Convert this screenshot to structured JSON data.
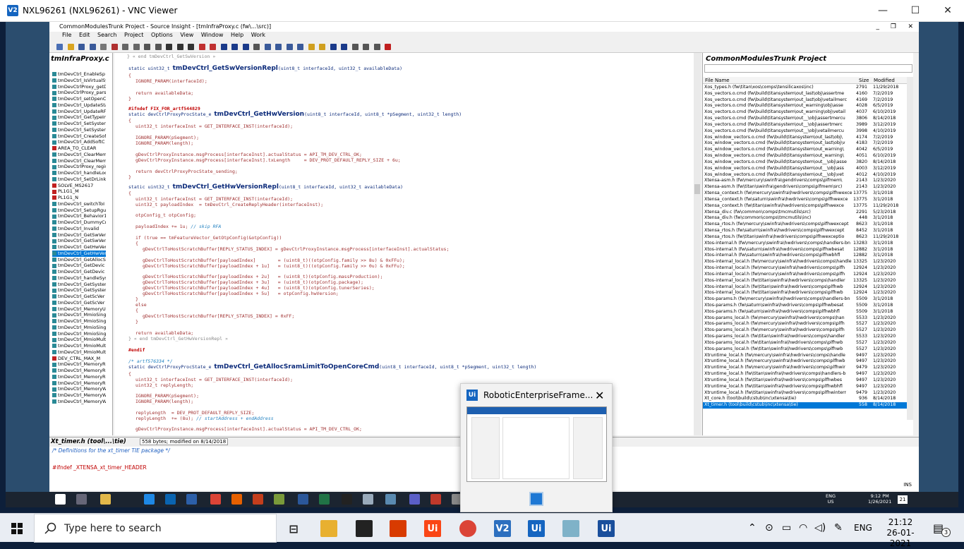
{
  "vnc": {
    "title": "NXL96261 (NXL96261) - VNC Viewer",
    "logo": "V2",
    "minimize": "—",
    "maximize": "☐",
    "close": "✕"
  },
  "si": {
    "title": "CommonModulesTrunk Project - Source Insight - [tmInfraProxy.c (fw\\...\\src)]",
    "menu": [
      "File",
      "Edit",
      "Search",
      "Project",
      "Options",
      "View",
      "Window",
      "Help",
      "Work"
    ],
    "window_controls": [
      "_",
      "❐",
      "✕"
    ],
    "symbol_window_title": "tmInfraProxy.c",
    "symbols": [
      {
        "label": "tmDevCtrl_EnableSp",
        "hash": false
      },
      {
        "label": "tmDevCtrl_IsVirtualSy",
        "hash": false
      },
      {
        "label": "tmDevCtrlProxy_getD",
        "hash": false
      },
      {
        "label": "tmDevCtrlProxy_pars",
        "hash": false
      },
      {
        "label": "tmDevCtrl_setOpenC",
        "hash": false
      },
      {
        "label": "tmDevCtrl_UpdateSta",
        "hash": false
      },
      {
        "label": "tmDevCtrl_UpdateRF",
        "hash": false
      },
      {
        "label": "tmDevCtrl_GetTypeIn",
        "hash": false
      },
      {
        "label": "tmDevCtrl_SetSysten",
        "hash": false
      },
      {
        "label": "tmDevCtrl_SetSysten",
        "hash": false
      },
      {
        "label": "tmDevCtrl_CreateSof",
        "hash": false
      },
      {
        "label": "tmDevCtrl_AddSoftC",
        "hash": false
      },
      {
        "label": "AREA_TO_CLEAR",
        "hash": true
      },
      {
        "label": "tmDevCtrl_ClearMem",
        "hash": false
      },
      {
        "label": "tmDevCtrl_ClearMem",
        "hash": false
      },
      {
        "label": "tmDevCtrlProxy_regis",
        "hash": false
      },
      {
        "label": "tmDevCtrl_handleLoc",
        "hash": false
      },
      {
        "label": "tmDevCtrl_SetDrLink",
        "hash": false
      },
      {
        "label": "SOLVE_MS2617",
        "hash": true
      },
      {
        "label": "PL1G1_M",
        "hash": true
      },
      {
        "label": "PL1G1_N",
        "hash": true
      },
      {
        "label": "tmDevCtrl_switchToI",
        "hash": false
      },
      {
        "label": "tmDevCtrl_SetupRgu",
        "hash": false
      },
      {
        "label": "tmDevCtrl_Behavior1",
        "hash": false
      },
      {
        "label": "tmDevCtrl_DummyCr",
        "hash": false
      },
      {
        "label": "tmDevCtrl_Invalid",
        "hash": false
      },
      {
        "label": "tmDevCtrl_GetSwVer",
        "hash": false
      },
      {
        "label": "tmDevCtrl_GetSwVer",
        "hash": false
      },
      {
        "label": "tmDevCtrl_GetHwVer",
        "hash": false
      },
      {
        "label": "tmDevCtrl_GetHwVer",
        "hash": false,
        "selected": true
      },
      {
        "label": "tmDevCtrl_GetAllocS",
        "hash": false
      },
      {
        "label": "tmDevCtrl_GetDevic",
        "hash": false
      },
      {
        "label": "tmDevCtrl_GetDevic",
        "hash": false
      },
      {
        "label": "tmDevCtrl_handleSys",
        "hash": false
      },
      {
        "label": "tmDevCtrl_GetSysten",
        "hash": false
      },
      {
        "label": "tmDevCtrl_GetSysten",
        "hash": false
      },
      {
        "label": "tmDevCtrl_GetScVer",
        "hash": false
      },
      {
        "label": "tmDevCtrl_GetScVer",
        "hash": false
      },
      {
        "label": "tmDevCtrl_MemoryU",
        "hash": false
      },
      {
        "label": "tmDevCtrl_MmioSing",
        "hash": false
      },
      {
        "label": "tmDevCtrl_MmioSing",
        "hash": false
      },
      {
        "label": "tmDevCtrl_MmioSing",
        "hash": false
      },
      {
        "label": "tmDevCtrl_MmioSing",
        "hash": false
      },
      {
        "label": "tmDevCtrl_MmioMult",
        "hash": false
      },
      {
        "label": "tmDevCtrl_MmioMult",
        "hash": false
      },
      {
        "label": "tmDevCtrl_MmioMult",
        "hash": false
      },
      {
        "label": "DEV_CTRL_MAX_M",
        "hash": true
      },
      {
        "label": "tmDevCtrl_MemoryR",
        "hash": false
      },
      {
        "label": "tmDevCtrl_MemoryR",
        "hash": false
      },
      {
        "label": "tmDevCtrl_MemoryR",
        "hash": false
      },
      {
        "label": "tmDevCtrl_MemoryR",
        "hash": false
      },
      {
        "label": "tmDevCtrl_MemoryW",
        "hash": false
      },
      {
        "label": "tmDevCtrl_MemoryW",
        "hash": false
      },
      {
        "label": "tmDevCtrl_MemoryW",
        "hash": false
      }
    ],
    "code": {
      "end_swver": "} « end tmDevCtrl_GetSwVersion »",
      "static1": "static uint32_t ",
      "fn1": "tmDevCtrl_GetSwVersionRepl",
      "args1": "(uint8_t interfaceId, uint32_t availableData)",
      "l_ignore1": "IGNORE_PARAM(interfaceId);",
      "l_ret1": "return availableData;",
      "l_ifndef": "#ifndef FIX_FOR_artf544829",
      "static2": "static devCtrlProxyProcState_e ",
      "fn2": "tmDevCtrl_GetHwVersion",
      "args2": "(uint8_t interfaceId, uint8_t *pSegment, uint32_t length)",
      "l_inst2": "uint32_t interfaceInst = GET_INTERFACE_INST(interfaceId);",
      "l_ign2a": "IGNORE_PARAM(pSegment);",
      "l_ign2b": "IGNORE_PARAM(length);",
      "l_act2": "gDevCtrlProxyInstance.msgProcess[interfaceInst].actualStatus = API_TM_DEV_CTRL_OK;",
      "l_tx2": "gDevCtrlProxyInstance.msgProcess[interfaceInst].txLength     = DEV_PROT_DEFAULT_REPLY_SIZE + 6u;",
      "l_ret2": "return devCtrlProxyProcState_sending;",
      "static3": "static uint32_t ",
      "fn3": "tmDevCtrl_GetHwVersionRepl",
      "args3": "(uint8_t interfaceId, uint32_t availableData)",
      "l_inst3": "uint32_t interfaceInst = GET_INTERFACE_INST(interfaceId);",
      "l_pidx3": "uint32_t payloadIndex  = tmDevCtrl_CreateReplyHeader(interfaceInst);",
      "l_otp3": "otpConfig_t otpConfig;",
      "l_pinc": "payloadIndex += 1u; ",
      "l_pinc_c": "// skip RFA",
      "l_if": "if (true == tmFeatureVector_GetOtpConfig(&otpConfig))",
      "l_rs1": "gDevCtrlToHostScratchBuffer[REPLY_STATUS_INDEX] = gDevCtrlProxyInstance.msgProcess[interfaceInst].actualStatus;",
      "l_p0": "gDevCtrlToHostScratchBuffer[payloadIndex]        = (uint8_t)((otpConfig.family >> 8u) & 0xFFu);",
      "l_p1": "gDevCtrlToHostScratchBuffer[payloadIndex + 1u]   = (uint8_t)((otpConfig.family >> 0u) & 0xFFu);",
      "l_p2": "gDevCtrlToHostScratchBuffer[payloadIndex + 2u]   = (uint8_t)(otpConfig.massProduction);",
      "l_p3": "gDevCtrlToHostScratchBuffer[payloadIndex + 3u]   = (uint8_t)(otpConfig.package);",
      "l_p4": "gDevCtrlToHostScratchBuffer[payloadIndex + 4u]   = (uint8_t)(otpConfig.tunerSeries);",
      "l_p5": "gDevCtrlToHostScratchBuffer[payloadIndex + 5u]   = otpConfig.hwVersion;",
      "l_else": "else",
      "l_rs2": "gDevCtrlToHostScratchBuffer[REPLY_STATUS_INDEX] = 0xFF;",
      "l_ret3": "return availableData;",
      "end_hwrepl": "} « end tmDevCtrl_GetHwVersionRepl »",
      "l_endif": "#endif",
      "l_artf": "/* artf576334 */",
      "static4": "static devCtrlProxyProcState_e ",
      "fn4": "tmDevCtrl_GetAllocSramLimitToOpenCoreCmd",
      "args4": "(uint8_t interfaceId, uint8_t *pSegment, uint32_t length)",
      "l_inst4": "uint32_t interfaceInst = GET_INTERFACE_INST(interfaceId);",
      "l_rlen4": "uint32_t replyLength;",
      "l_ign4a": "IGNORE_PARAM(pSegment);",
      "l_ign4b": "IGNORE_PARAM(length);",
      "l_rl4a": "replyLength  = DEV_PROT_DEFAULT_REPLY_SIZE;",
      "l_rl4b": "replyLength  += (8u); ",
      "l_rl4b_c": "// startAddress + endAddress",
      "l_act4": "gDevCtrlProxyInstance.msgProcess[interfaceInst].actualStatus = API_TM_DEV_CTRL_OK;"
    },
    "project": {
      "title": "CommonModulesTrunk Project",
      "col_name": "File Name",
      "col_size": "Size",
      "col_modified": "Modified",
      "files": [
        {
          "name": "Xos_types.h (fw\\titan\\xos\\comps\\tensilicaxos\\inc)",
          "size": "2791",
          "mod": "11/29/2018"
        },
        {
          "name": "Xos_vectors.o.cmd (fw\\build\\titansystem\\out_last\\obj\\assertme",
          "size": "4160",
          "mod": "7/2/2019"
        },
        {
          "name": "Xos_vectors.o.cmd (fw\\build\\titansystem\\out_last\\obj\\vetailmerc",
          "size": "4169",
          "mod": "7/2/2019"
        },
        {
          "name": "Xos_vectors.o.cmd (fw\\build\\titansystem\\out_warning\\obj\\asse",
          "size": "4028",
          "mod": "6/5/2019"
        },
        {
          "name": "Xos_vectors.o.cmd (fw\\build\\titansystem\\out_warning\\obj\\vetail",
          "size": "4037",
          "mod": "6/10/2019"
        },
        {
          "name": "Xos_vectors.o.cmd (fw\\build\\titansystem\\out__\\obj\\assertmercu",
          "size": "3806",
          "mod": "8/14/2018"
        },
        {
          "name": "Xos_vectors.o.cmd (fw\\build\\titansystem\\out__\\obj\\assertmerc",
          "size": "3989",
          "mod": "3/12/2019"
        },
        {
          "name": "Xos_vectors.o.cmd (fw\\build\\titansystem\\out__\\obj\\vetailmercu",
          "size": "3998",
          "mod": "4/10/2019"
        },
        {
          "name": "Xos_window_vectors.o.cmd (fw\\build\\titansystem\\out_last\\obj\\",
          "size": "4174",
          "mod": "7/2/2019"
        },
        {
          "name": "Xos_window_vectors.o.cmd (fw\\build\\titansystem\\out_last\\obj\\v",
          "size": "4183",
          "mod": "7/2/2019"
        },
        {
          "name": "Xos_window_vectors.o.cmd (fw\\build\\titansystem\\out_warning\\",
          "size": "4042",
          "mod": "6/5/2019"
        },
        {
          "name": "Xos_window_vectors.o.cmd (fw\\build\\titansystem\\out_warning\\",
          "size": "4051",
          "mod": "6/10/2019"
        },
        {
          "name": "Xos_window_vectors.o.cmd (fw\\build\\titansystem\\out__\\obj\\asse",
          "size": "3820",
          "mod": "8/14/2018"
        },
        {
          "name": "Xos_window_vectors.o.cmd (fw\\build\\titansystem\\out__\\obj\\ass",
          "size": "4003",
          "mod": "3/12/2019"
        },
        {
          "name": "Xos_window_vectors.o.cmd (fw\\build\\titansystem\\out__\\obj\\vet",
          "size": "4012",
          "mod": "4/10/2019"
        },
        {
          "name": "Xtensa-asm.h (fw\\mercury\\swinfra\\gendrivers\\comps\\plfmem\\",
          "size": "2143",
          "mod": "1/23/2020"
        },
        {
          "name": "Xtensa-asm.h (fw\\titan\\swinfra\\gendrivers\\comps\\plfmem\\src)",
          "size": "2143",
          "mod": "1/23/2020"
        },
        {
          "name": "Xtensa_context.h (fw\\mercury\\swinfra\\hwdrivers\\comps\\plfhwexce",
          "size": "13775",
          "mod": "3/1/2018"
        },
        {
          "name": "Xtensa_context.h (fw\\saturn\\swinfra\\hwdrivers\\comps\\plfhwexce",
          "size": "13775",
          "mod": "3/1/2018"
        },
        {
          "name": "Xtensa_context.h (fw\\titan\\swinfra\\hwdrivers\\comps\\plfhwexce",
          "size": "13775",
          "mod": "11/29/2018"
        },
        {
          "name": "Xtensa_div.c (fw\\common\\comps\\tmcmutils\\src)",
          "size": "2291",
          "mod": "5/23/2018"
        },
        {
          "name": "Xtensa_div.h (fw\\common\\comps\\tmcmutils\\inc)",
          "size": "448",
          "mod": "3/1/2018"
        },
        {
          "name": "Xtensa_rtos.h (fw\\mercury\\swinfra\\hwdrivers\\comps\\plfhwexcept",
          "size": "8623",
          "mod": "3/1/2018"
        },
        {
          "name": "Xtensa_rtos.h (fw\\saturn\\swinfra\\hwdrivers\\comps\\plfhwexcept",
          "size": "8452",
          "mod": "3/1/2018"
        },
        {
          "name": "Xtensa_rtos.h (fw\\titan\\swinfra\\hwdrivers\\comps\\plfhwexceptio",
          "size": "8623",
          "mod": "11/29/2018"
        },
        {
          "name": "Xtos-internal.h (fw\\mercury\\swinfra\\hwdrivers\\comps\\handlers-bn",
          "size": "13283",
          "mod": "3/1/2018"
        },
        {
          "name": "Xtos-internal.h (fw\\saturn\\swinfra\\hwdrivers\\comps\\plfhwbesat",
          "size": "12882",
          "mod": "3/1/2018"
        },
        {
          "name": "Xtos-internal.h (fw\\saturn\\swinfra\\hwdrivers\\comps\\plfhwbhfl",
          "size": "12882",
          "mod": "3/1/2018"
        },
        {
          "name": "Xtos-internal_local.h (fw\\mercury\\swinfra\\hwdrivers\\comps\\handle",
          "size": "13325",
          "mod": "1/23/2020"
        },
        {
          "name": "Xtos-internal_local.h (fw\\mercury\\swinfra\\hwdrivers\\comps\\plfh",
          "size": "12924",
          "mod": "1/23/2020"
        },
        {
          "name": "Xtos-internal_local.h (fw\\mercury\\swinfra\\hwdrivers\\comps\\plfh",
          "size": "12924",
          "mod": "1/23/2020"
        },
        {
          "name": "Xtos-internal_local.h (fw\\titan\\swinfra\\hwdrivers\\comps\\handler",
          "size": "13325",
          "mod": "1/23/2020"
        },
        {
          "name": "Xtos-internal_local.h (fw\\titan\\swinfra\\hwdrivers\\comps\\plfhwb",
          "size": "12924",
          "mod": "1/23/2020"
        },
        {
          "name": "Xtos-internal_local.h (fw\\titan\\swinfra\\hwdrivers\\comps\\plfhwb",
          "size": "12924",
          "mod": "1/23/2020"
        },
        {
          "name": "Xtos-params.h (fw\\mercury\\swinfra\\hwdrivers\\comps\\handlers-bn",
          "size": "5509",
          "mod": "3/1/2018"
        },
        {
          "name": "Xtos-params.h (fw\\saturn\\swinfra\\hwdrivers\\comps\\plfhwbesat",
          "size": "5509",
          "mod": "3/1/2018"
        },
        {
          "name": "Xtos-params.h (fw\\saturn\\swinfra\\hwdrivers\\comps\\plfhwbhfl",
          "size": "5509",
          "mod": "3/1/2018"
        },
        {
          "name": "Xtos-params_local.h (fw\\mercury\\swinfra\\hwdrivers\\comps\\han",
          "size": "5533",
          "mod": "1/23/2020"
        },
        {
          "name": "Xtos-params_local.h (fw\\mercury\\swinfra\\hwdrivers\\comps\\plfh",
          "size": "5527",
          "mod": "1/23/2020"
        },
        {
          "name": "Xtos-params_local.h (fw\\mercury\\swinfra\\hwdrivers\\comps\\plfh",
          "size": "5527",
          "mod": "1/23/2020"
        },
        {
          "name": "Xtos-params_local.h (fw\\titan\\swinfra\\hwdrivers\\comps\\handler",
          "size": "5533",
          "mod": "1/23/2020"
        },
        {
          "name": "Xtos-params_local.h (fw\\titan\\swinfra\\hwdrivers\\comps\\plfhwb",
          "size": "5527",
          "mod": "1/23/2020"
        },
        {
          "name": "Xtos-params_local.h (fw\\titan\\swinfra\\hwdrivers\\comps\\plfhwb",
          "size": "5527",
          "mod": "1/23/2020"
        },
        {
          "name": "Xtruntime_local.h (fw\\mercury\\swinfra\\hwdrivers\\comps\\handle",
          "size": "9497",
          "mod": "1/23/2020"
        },
        {
          "name": "Xtruntime_local.h (fw\\mercury\\swinfra\\hwdrivers\\comps\\plfhwb",
          "size": "9497",
          "mod": "1/23/2020"
        },
        {
          "name": "Xtruntime_local.h (fw\\mercury\\swinfra\\hwdrivers\\comps\\plfhwir",
          "size": "9479",
          "mod": "1/23/2020"
        },
        {
          "name": "Xtruntime_local.h (fw\\titan\\swinfra\\hwdrivers\\comps\\handlers-b",
          "size": "9497",
          "mod": "1/23/2020"
        },
        {
          "name": "Xtruntime_local.h (fw\\titan\\swinfra\\hwdrivers\\comps\\plfhwbes",
          "size": "9497",
          "mod": "1/23/2020"
        },
        {
          "name": "Xtruntime_local.h (fw\\titan\\swinfra\\hwdrivers\\comps\\plfhwbhfl",
          "size": "9497",
          "mod": "1/23/2020"
        },
        {
          "name": "Xtruntime_local.h (fw\\titan\\swinfra\\hwdrivers\\comps\\plfhwinterr",
          "size": "9479",
          "mod": "1/23/2020"
        },
        {
          "name": "Xt_core.h (tool\\build\\cstub\\inc\\xtensa\\tie)",
          "size": "936",
          "mod": "8/14/2018"
        },
        {
          "name": "Xt_timer.h (tool\\build\\cstub\\inc\\xtensa\\tie)",
          "size": "558",
          "mod": "8/14/2018",
          "selected": true
        }
      ]
    },
    "context": {
      "title": "Xt_timer.h (tool\\...\\tie)",
      "info": "558 bytes; modified on 8/14/2018",
      "line1": "/* Definitions for the xt_timer TIE package */",
      "line2": "#ifndef _XTENSA_xt_timer_HEADER"
    },
    "status_ins": "INS"
  },
  "remote_taskbar": {
    "lang": "ENG",
    "region": "US",
    "time": "9:12 PM",
    "date": "1/26/2021",
    "badge": "21"
  },
  "thumbnail": {
    "title": "RoboticEnterpriseFrame..."
  },
  "taskbar": {
    "search_placeholder": "Type here to search",
    "lang": "ENG",
    "time": "21:12",
    "date": "26-01-2021",
    "notif": "3"
  }
}
